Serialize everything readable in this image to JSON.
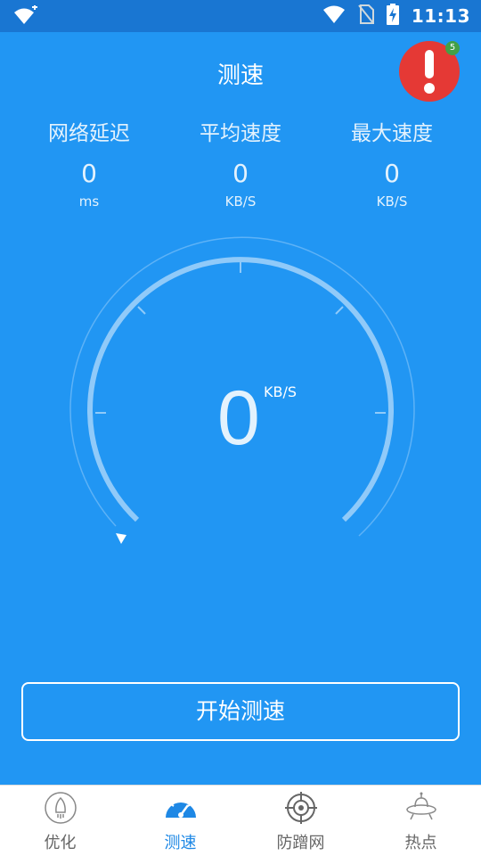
{
  "status_bar": {
    "time": "11:13"
  },
  "header": {
    "title": "测速",
    "alert_badge_count": "5"
  },
  "stats": [
    {
      "label": "网络延迟",
      "value": "0",
      "unit": "ms"
    },
    {
      "label": "平均速度",
      "value": "0",
      "unit": "KB/S"
    },
    {
      "label": "最大速度",
      "value": "0",
      "unit": "KB/S"
    }
  ],
  "gauge": {
    "value": "0",
    "unit": "KB/S"
  },
  "start_button": {
    "label": "开始测速"
  },
  "bottom_nav": {
    "items": [
      {
        "label": "优化",
        "icon": "rocket-icon",
        "active": false
      },
      {
        "label": "测速",
        "icon": "speedometer-icon",
        "active": true
      },
      {
        "label": "防蹭网",
        "icon": "target-icon",
        "active": false
      },
      {
        "label": "热点",
        "icon": "ufo-icon",
        "active": false
      }
    ]
  },
  "colors": {
    "background": "#2196F3",
    "status_bar": "#1976D2",
    "alert": "#E53935",
    "badge": "#43A047",
    "nav_active": "#1E88E5"
  }
}
